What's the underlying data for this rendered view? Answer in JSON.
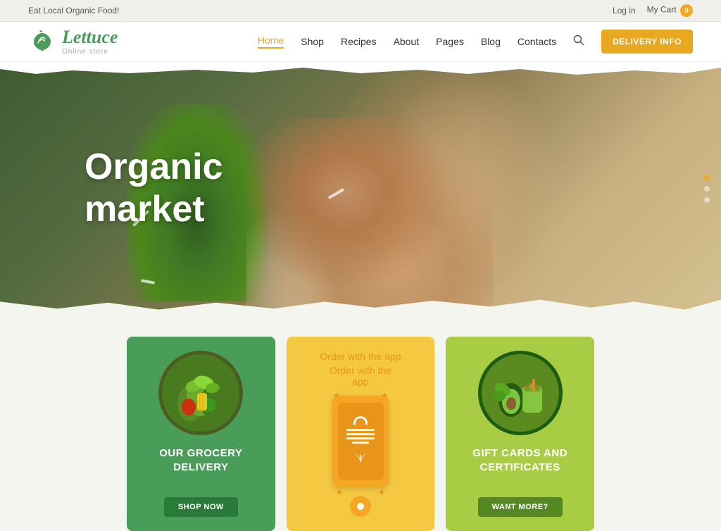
{
  "topbar": {
    "promo_text": "Eat Local Organic Food!",
    "login_label": "Log in",
    "cart_label": "My Cart",
    "cart_count": "0"
  },
  "header": {
    "logo_name": "Lettuce",
    "logo_subtitle": "Online store",
    "nav": {
      "home": "Home",
      "shop": "Shop",
      "recipes": "Recipes",
      "about": "About",
      "pages": "Pages",
      "blog": "Blog",
      "contacts": "Contacts"
    },
    "delivery_btn": "DELIVERY INFO"
  },
  "hero": {
    "title_line1": "Organic",
    "title_line2": "market",
    "dots": [
      true,
      false,
      false
    ]
  },
  "cards": [
    {
      "id": "grocery",
      "title": "OUR GROCERY\nDELIVERY",
      "btn_label": "SHOP NOW",
      "color": "green"
    },
    {
      "id": "app",
      "subtitle": "Order with the\napp",
      "color": "yellow"
    },
    {
      "id": "gift",
      "title": "GIFT CARDS AND\nCERTIFICATES",
      "btn_label": "WANT MORE?",
      "color": "lime"
    }
  ]
}
